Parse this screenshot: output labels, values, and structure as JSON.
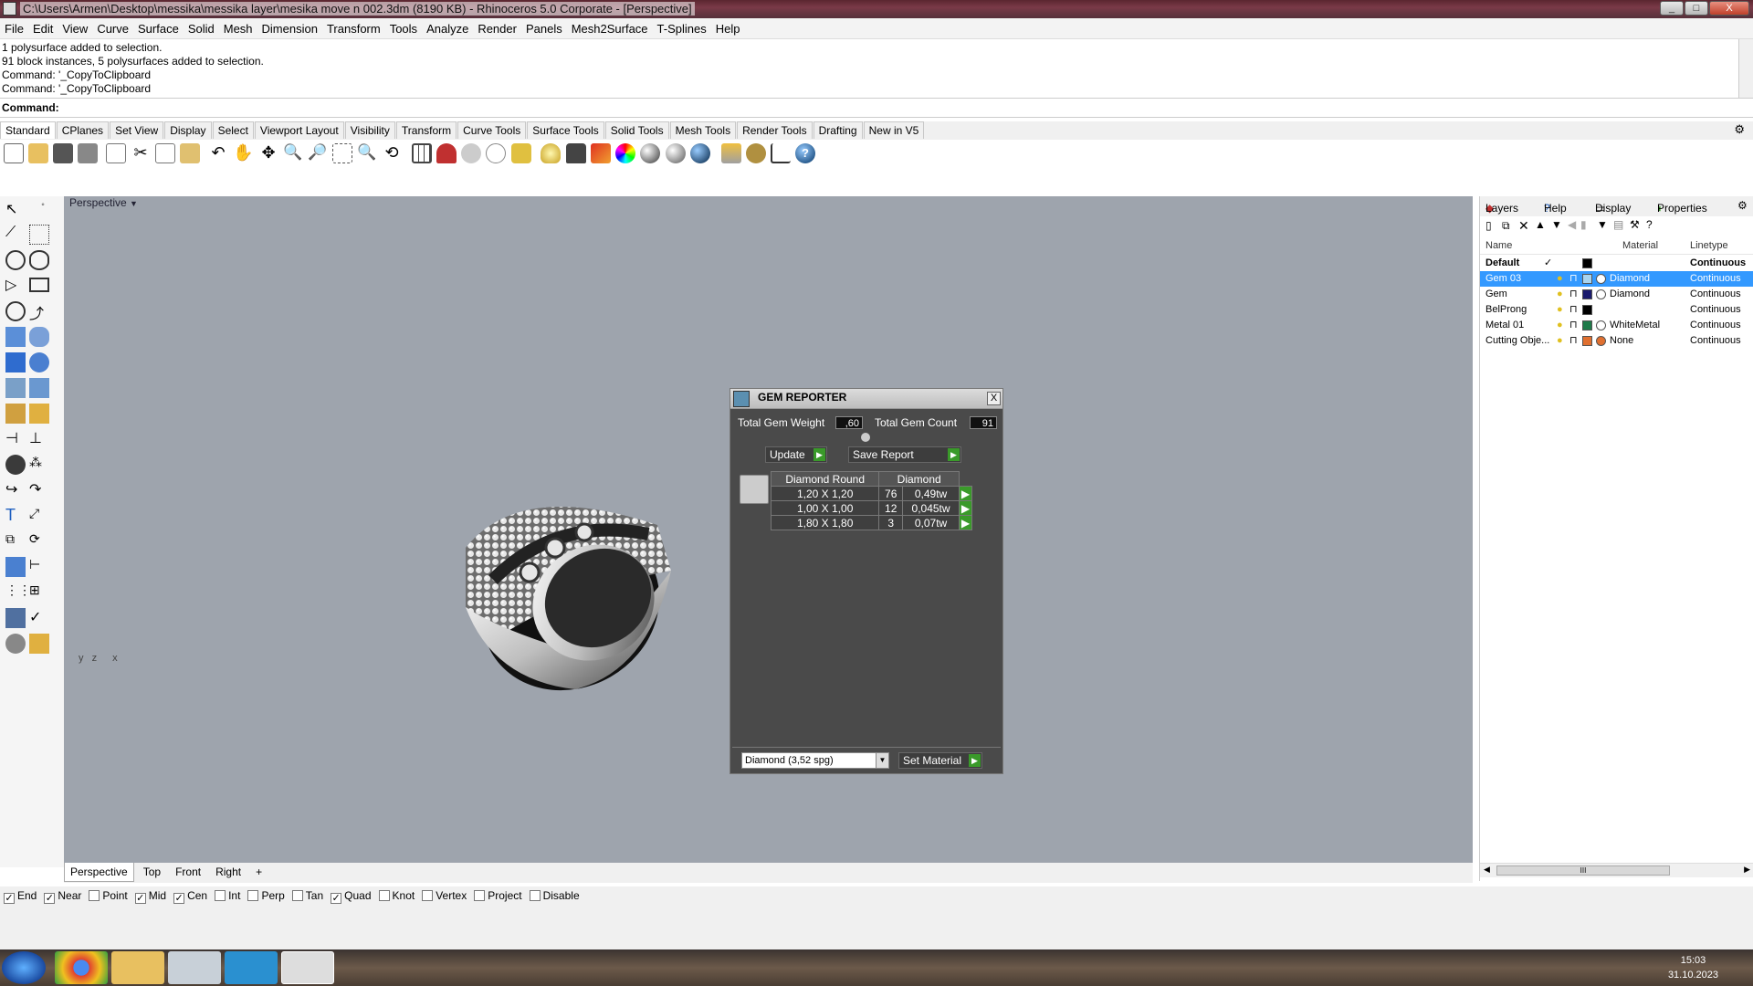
{
  "window": {
    "title": "C:\\Users\\Armen\\Desktop\\messika\\messika layer\\mesika move n 002.3dm (8190 KB) - Rhinoceros  5.0 Corporate - [Perspective]",
    "minimize": "_",
    "maximize": "□",
    "close": "X"
  },
  "menu": [
    "File",
    "Edit",
    "View",
    "Curve",
    "Surface",
    "Solid",
    "Mesh",
    "Dimension",
    "Transform",
    "Tools",
    "Analyze",
    "Render",
    "Panels",
    "Mesh2Surface",
    "T-Splines",
    "Help"
  ],
  "history": [
    "1 polysurface added to selection.",
    "91 block instances, 5 polysurfaces added to selection.",
    "Command: '_CopyToClipboard",
    "Command: '_CopyToClipboard"
  ],
  "command": {
    "label": "Command:",
    "value": ""
  },
  "toolbar_tabs": [
    "Standard",
    "CPlanes",
    "Set View",
    "Display",
    "Select",
    "Viewport Layout",
    "Visibility",
    "Transform",
    "Curve Tools",
    "Surface Tools",
    "Solid Tools",
    "Mesh Tools",
    "Render Tools",
    "Drafting",
    "New in V5"
  ],
  "viewport": {
    "label": "Perspective",
    "tabs": [
      "Perspective",
      "Top",
      "Front",
      "Right"
    ],
    "add_tab": "+",
    "axes": {
      "y": "y",
      "z": "z",
      "x": "x"
    }
  },
  "osnaps": [
    {
      "label": "End",
      "checked": true
    },
    {
      "label": "Near",
      "checked": true
    },
    {
      "label": "Point",
      "checked": false
    },
    {
      "label": "Mid",
      "checked": true
    },
    {
      "label": "Cen",
      "checked": true
    },
    {
      "label": "Int",
      "checked": false
    },
    {
      "label": "Perp",
      "checked": false
    },
    {
      "label": "Tan",
      "checked": false
    },
    {
      "label": "Quad",
      "checked": true
    },
    {
      "label": "Knot",
      "checked": false
    },
    {
      "label": "Vertex",
      "checked": false
    },
    {
      "label": "Project",
      "checked": false
    },
    {
      "label": "Disable",
      "checked": false
    }
  ],
  "panel": {
    "tabs": [
      "Layers",
      "Help",
      "Display",
      "Properties"
    ],
    "columns": {
      "name": "Name",
      "material": "Material",
      "linetype": "Linetype"
    },
    "layers": [
      {
        "name": "Default",
        "check": "✓",
        "material": "",
        "linetype": "Continuous",
        "color": "#000000",
        "selected": false,
        "bold": true
      },
      {
        "name": "Gem 03",
        "check": "",
        "material": "Diamond",
        "linetype": "Continuous",
        "color": "#a8d4f0",
        "selected": true,
        "bold": false
      },
      {
        "name": "Gem",
        "check": "",
        "material": "Diamond",
        "linetype": "Continuous",
        "color": "#1a1a6e",
        "selected": false,
        "bold": false
      },
      {
        "name": "BelProng",
        "check": "",
        "material": "",
        "linetype": "Continuous",
        "color": "#000000",
        "selected": false,
        "bold": false
      },
      {
        "name": "Metal 01",
        "check": "",
        "material": "WhiteMetal",
        "linetype": "Continuous",
        "color": "#1f7a4a",
        "selected": false,
        "bold": false
      },
      {
        "name": "Cutting Obje...",
        "check": "",
        "material": "None",
        "linetype": "Continuous",
        "color": "#e07030",
        "selected": false,
        "bold": false
      }
    ],
    "scroll_grip": "III"
  },
  "gem_reporter": {
    "title": "GEM REPORTER",
    "close": "X",
    "total_weight_label": "Total Gem Weight",
    "total_weight": ",60",
    "total_count_label": "Total Gem Count",
    "total_count": "91",
    "update_label": "Update",
    "save_label": "Save Report",
    "table_header": [
      "Diamond Round",
      "Diamond"
    ],
    "rows": [
      {
        "size": "1,20 X 1,20",
        "count": "76",
        "weight": "0,49tw"
      },
      {
        "size": "1,00 X 1,00",
        "count": "12",
        "weight": "0,045tw"
      },
      {
        "size": "1,80 X 1,80",
        "count": "3",
        "weight": "0,07tw"
      }
    ],
    "material_select": "Diamond     (3,52 spg)",
    "set_material_label": "Set Material",
    "go": "▶"
  },
  "taskbar": {
    "time": "15:03",
    "date": "31.10.2023"
  }
}
